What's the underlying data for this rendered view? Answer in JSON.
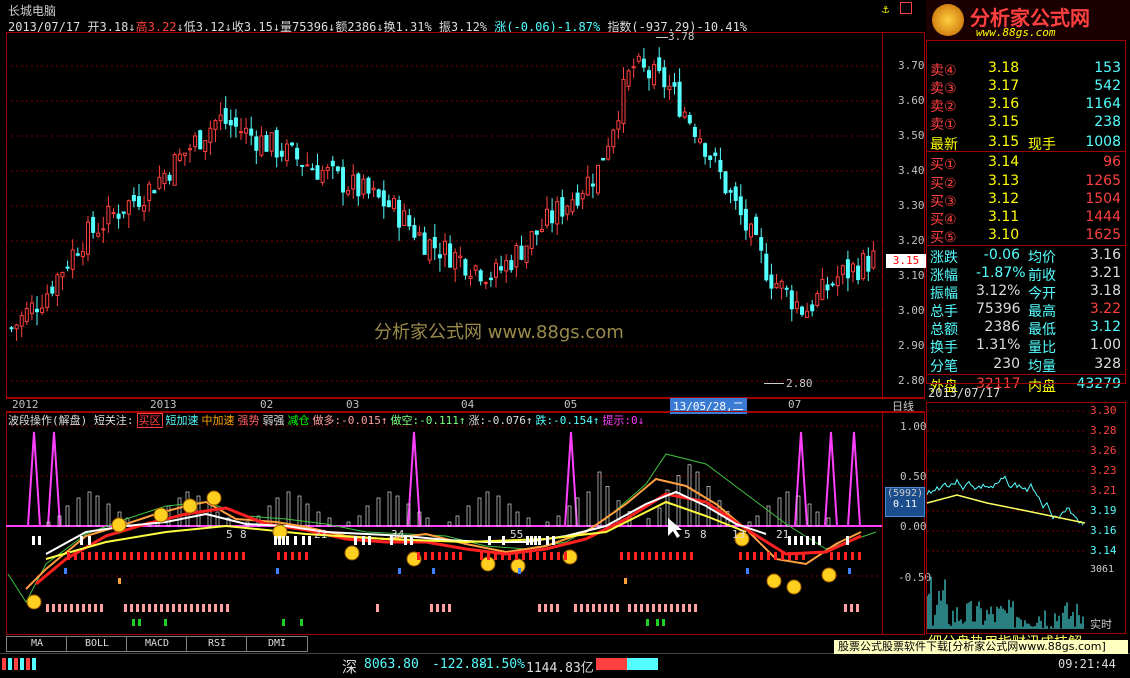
{
  "header": {
    "title": "长城电脑",
    "info": {
      "date": "2013/07/17",
      "open": "开3.18",
      "high": "高3.22",
      "low": "低3.12",
      "close": "收3.15",
      "vol": "量75396",
      "amt": "额2386",
      "turn": "换1.31%",
      "amp": "振3.12%",
      "chg": "涨(-0.06)-1.87%",
      "idx": "指数(-937.29)-10.41%"
    }
  },
  "main_chart": {
    "y_ticks": [
      "3.70",
      "3.60",
      "3.50",
      "3.40",
      "3.30",
      "3.20",
      "3.10",
      "3.00",
      "2.90",
      "2.80"
    ],
    "current_price": "3.15",
    "high_mark": "3.78",
    "low_mark": "2.80",
    "watermark": "分析家公式网 www.88gs.com",
    "x_labels": [
      "2012",
      "2013",
      "02",
      "03",
      "04",
      "05",
      "13/05/28,二",
      "07"
    ],
    "period_label": "日线"
  },
  "chart_data": [
    {
      "type": "candlestick",
      "title": "长城电脑",
      "y_range": [
        2.78,
        3.78
      ],
      "approx_close_path": [
        2.95,
        3.05,
        3.2,
        3.28,
        3.35,
        3.45,
        3.55,
        3.5,
        3.45,
        3.4,
        3.35,
        3.3,
        3.2,
        3.15,
        3.1,
        3.2,
        3.3,
        3.4,
        3.7,
        3.65,
        3.5,
        3.3,
        3.1,
        3.0,
        3.1,
        3.15
      ]
    },
    {
      "type": "line",
      "title": "波段操作(解盘)",
      "y_ticks": [
        "1.00",
        "0.50",
        "0.00",
        "-0.50"
      ],
      "legend": [
        "短关注",
        "买区",
        "短加速",
        "中加速",
        "强势",
        "弱强",
        "减仓",
        "做多:-0.015",
        "做空:-0.111",
        "涨:-0.076",
        "跌:-0.154",
        "提示:0"
      ],
      "value_box": [
        "(5992)",
        "0.11"
      ],
      "numbers": [
        "5",
        "8",
        "21",
        "34",
        "55",
        "5",
        "8",
        "13",
        "21"
      ]
    }
  ],
  "indicator": {
    "name": "波段操作(解盘)",
    "legend": [
      {
        "text": "短关注:",
        "color": "#dddddd"
      },
      {
        "text": "买区",
        "color": "#ff4040"
      },
      {
        "text": "短加速",
        "color": "#54ffff"
      },
      {
        "text": "中加速",
        "color": "#ffa500"
      },
      {
        "text": "强势",
        "color": "#ff6060"
      },
      {
        "text": "弱强",
        "color": "#dddddd"
      },
      {
        "text": "减仓",
        "color": "#00ff00"
      },
      {
        "text": "做多:-0.015↑",
        "color": "#ffa0a0"
      },
      {
        "text": "做空:-0.111↑",
        "color": "#80ff80"
      },
      {
        "text": "涨:-0.076↑",
        "color": "#dddddd"
      },
      {
        "text": "跌:-0.154↑",
        "color": "#54ffff"
      },
      {
        "text": "提示:0↓",
        "color": "#ff40ff"
      }
    ],
    "y_ticks": [
      "1.00",
      "0.50",
      "0.00",
      "-0.50"
    ],
    "box_top": "(5992)",
    "box_val": "0.11",
    "fib": [
      "5",
      "8",
      "21",
      "34",
      "55",
      "5",
      "8",
      "13",
      "21"
    ]
  },
  "tabs": [
    "MA",
    "BOLL",
    "MACD",
    "RSI",
    "DMI"
  ],
  "side": {
    "logo": "分析家公式网",
    "logo_url": "www.88gs.com",
    "asks": [
      {
        "label": "卖④",
        "price": "3.18",
        "vol": "153"
      },
      {
        "label": "卖③",
        "price": "3.17",
        "vol": "542"
      },
      {
        "label": "卖②",
        "price": "3.16",
        "vol": "1164"
      },
      {
        "label": "卖①",
        "price": "3.15",
        "vol": "238"
      }
    ],
    "last": {
      "label": "最新",
      "price": "3.15",
      "label2": "现手",
      "vol": "1008"
    },
    "bids": [
      {
        "label": "买①",
        "price": "3.14",
        "vol": "96"
      },
      {
        "label": "买②",
        "price": "3.13",
        "vol": "1265"
      },
      {
        "label": "买③",
        "price": "3.12",
        "vol": "1504"
      },
      {
        "label": "买④",
        "price": "3.11",
        "vol": "1444"
      },
      {
        "label": "买⑤",
        "price": "3.10",
        "vol": "1625"
      }
    ],
    "stats": [
      {
        "l1": "涨跌",
        "v1": "-0.06",
        "l2": "均价",
        "v2": "3.16"
      },
      {
        "l1": "涨幅",
        "v1": "-1.87%",
        "l2": "前收",
        "v2": "3.21"
      },
      {
        "l1": "振幅",
        "v1": "3.12%",
        "l2": "今开",
        "v2": "3.18"
      },
      {
        "l1": "总手",
        "v1": "75396",
        "l2": "最高",
        "v2": "3.22"
      },
      {
        "l1": "总额",
        "v1": "2386",
        "l2": "最低",
        "v2": "3.12"
      },
      {
        "l1": "换手",
        "v1": "1.31%",
        "l2": "量比",
        "v2": "1.00"
      },
      {
        "l1": "分笔",
        "v1": "230",
        "l2": "均量",
        "v2": "328"
      }
    ],
    "outer": {
      "l1": "外盘",
      "v1": "32117",
      "l2": "内盘",
      "v2": "43279"
    },
    "date": "2013/07/17",
    "mini_ticks": [
      "3.30",
      "3.28",
      "3.26",
      "3.23",
      "3.21",
      "3.19",
      "3.16",
      "3.14"
    ],
    "mini_vol": "3061",
    "realtime": "实时",
    "bottom_text": "细分盘热用指财讯成技解"
  },
  "status": {
    "market": "深",
    "index": "8063.80",
    "change": "-122.88",
    "pct": "-1.50%",
    "amount": "1144.83亿",
    "ad": "股票公式股票软件下载[分析家公式网www.88gs.com]",
    "time": "09:21:44"
  }
}
